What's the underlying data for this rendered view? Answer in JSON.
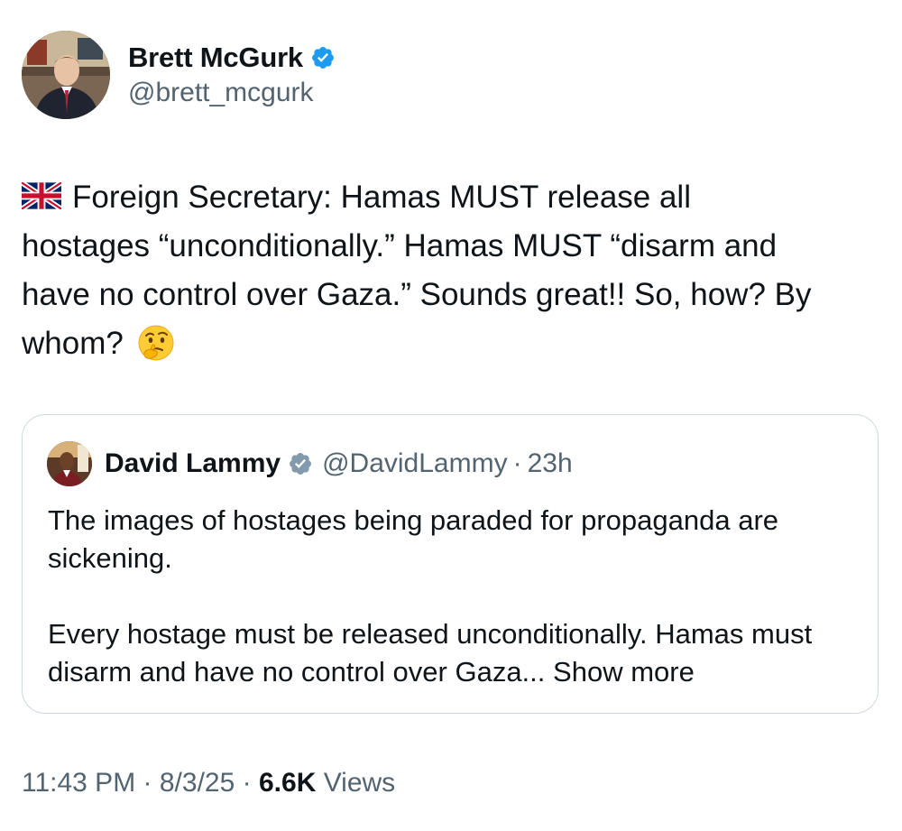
{
  "author": {
    "display_name": "Brett McGurk",
    "handle": "@brett_mcgurk",
    "verified": true
  },
  "tweet": {
    "flag_icon": "uk-flag-emoji",
    "text_lines": [
      "Foreign Secretary: Hamas MUST release all",
      "hostages “unconditionally.” Hamas MUST “disarm and",
      "have no control over Gaza.” Sounds great!! So, how? By",
      "whom?"
    ],
    "emoji": "thinking-face-emoji"
  },
  "quote": {
    "display_name": "David Lammy",
    "handle": "@DavidLammy",
    "separator": "·",
    "time": "23h",
    "verified": true,
    "paragraph1": "The images of hostages being paraded for propaganda are sickening.",
    "paragraph2": "Every hostage must be released unconditionally. Hamas must disarm and have no control over Gaza...",
    "show_more": "Show more"
  },
  "footer": {
    "time": "11:43 PM",
    "sep1": "·",
    "date": "8/3/25",
    "sep2": "·",
    "views_count": "6.6K",
    "views_label": "Views"
  },
  "colors": {
    "verified_blue": "#1d9bf0",
    "verified_gray": "#829aab",
    "secondary_text": "#536471",
    "primary_text": "#0f1419",
    "border": "#cfd9de"
  }
}
